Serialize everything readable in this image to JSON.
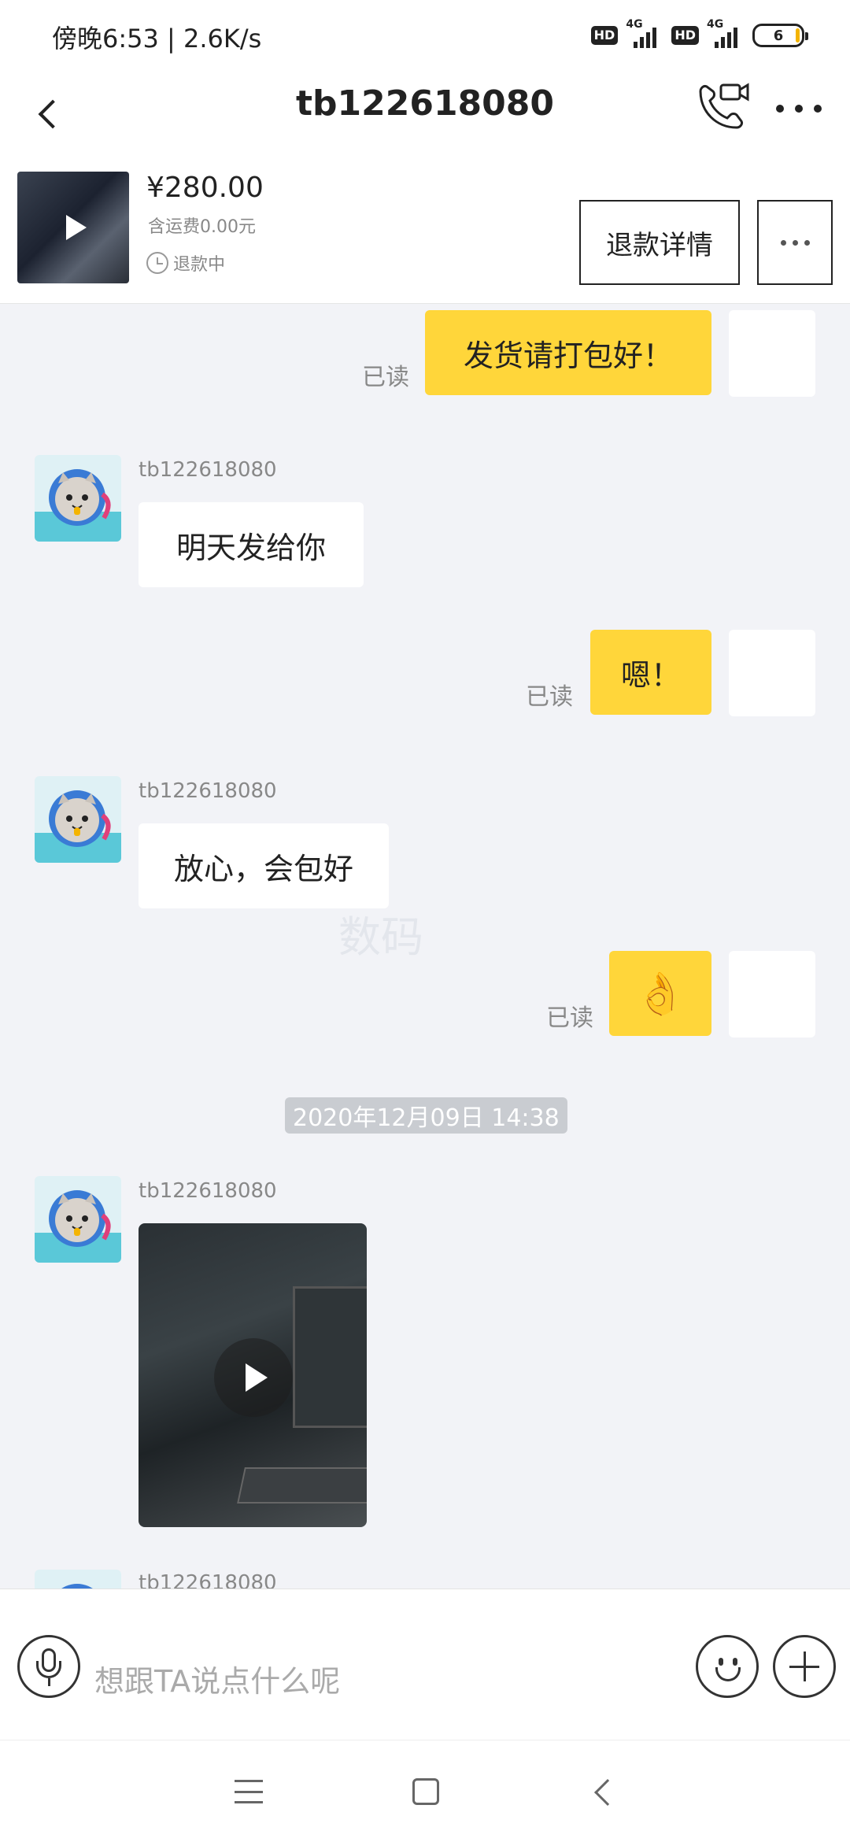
{
  "status_bar": {
    "time_speed": "傍晚6:53 | 2.6K/s",
    "hd_label": "HD",
    "network_label": "4G",
    "battery_level": "6"
  },
  "header": {
    "title": "tb122618080",
    "icons": [
      "back-arrow-icon",
      "video-call-icon",
      "more-icon"
    ]
  },
  "product": {
    "price": "¥280.00",
    "shipping": "含运费0.00元",
    "status": "退款中",
    "refund_button": "退款详情"
  },
  "chat": {
    "messages": [
      {
        "from": "me",
        "text": "发货请打包好！",
        "read": "已读"
      },
      {
        "from": "tb122618080",
        "sender": "tb122618080",
        "text": "明天发给你"
      },
      {
        "from": "me",
        "text": "嗯！",
        "read": "已读"
      },
      {
        "from": "tb122618080",
        "sender": "tb122618080",
        "text": "放心，会包好"
      },
      {
        "from": "me",
        "emoji": "👌",
        "read": "已读"
      },
      {
        "from": "tb122618080",
        "sender": "tb122618080",
        "type": "video"
      },
      {
        "from": "tb122618080",
        "sender": "tb122618080"
      }
    ],
    "timestamp": "2020年12月09日 14:38"
  },
  "input": {
    "placeholder": "想跟TA说点什么呢"
  },
  "colors": {
    "my_bubble": "#ffd63a",
    "their_bubble": "#ffffff",
    "background": "#f2f3f7"
  }
}
